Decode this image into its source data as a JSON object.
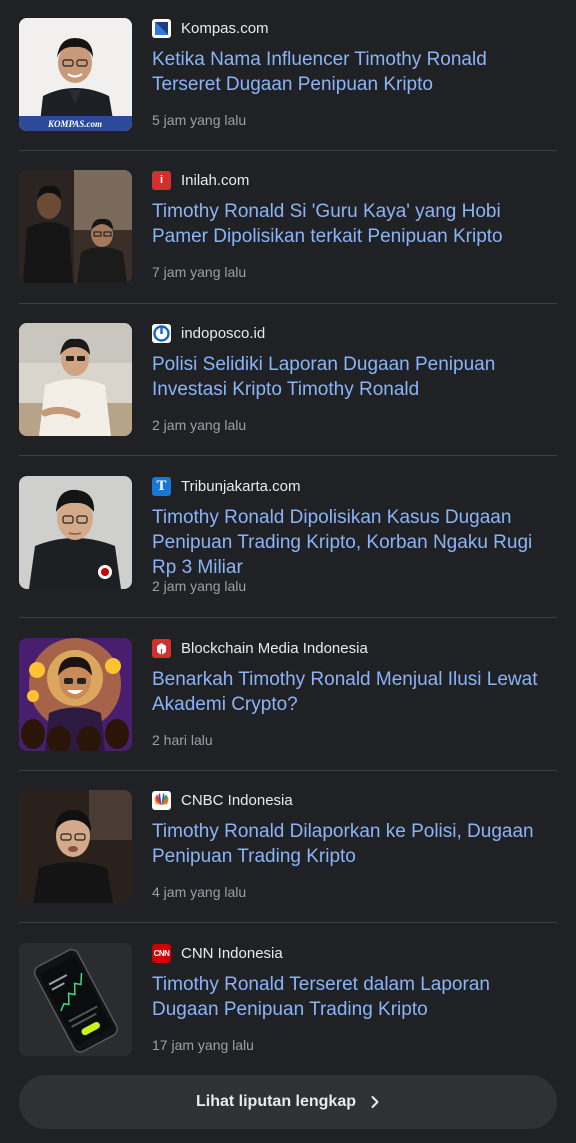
{
  "articles": [
    {
      "source": "Kompas.com",
      "favicon_icon": "kompas-logo-icon",
      "favicon_color": "#1a3c8a",
      "headline": "Ketika Nama Influencer Timothy Ronald Terseret Dugaan Penipuan Kripto",
      "time": "5 jam yang lalu",
      "thumb_watermark": "KOMPAS.com"
    },
    {
      "source": "Inilah.com",
      "favicon_icon": "inilah-logo-icon",
      "favicon_color": "#d32f2f",
      "headline": "Timothy Ronald Si 'Guru Kaya' yang Hobi Pamer Dipolisikan terkait Penipuan Kripto",
      "time": "7 jam yang lalu"
    },
    {
      "source": "indoposco.id",
      "favicon_icon": "indoposco-logo-icon",
      "favicon_color": "#1565c0",
      "headline": "Polisi Selidiki Laporan Dugaan Penipuan Investasi Kripto Timothy Ronald",
      "time": "2 jam yang lalu"
    },
    {
      "source": "Tribunjakarta.com",
      "favicon_icon": "tribun-logo-icon",
      "favicon_color": "#1976d2",
      "headline": "Timothy Ronald Dipolisikan Kasus Dugaan Penipuan Trading Kripto, Korban Ngaku Rugi Rp 3 Miliar",
      "time": "2 jam yang lalu"
    },
    {
      "source": "Blockchain Media Indonesia",
      "favicon_icon": "blockchain-media-logo-icon",
      "favicon_color": "#d32f2f",
      "headline": "Benarkah Timothy Ronald Menjual Ilusi Lewat Akademi Crypto?",
      "time": "2 hari lalu"
    },
    {
      "source": "CNBC Indonesia",
      "favicon_icon": "cnbc-peacock-icon",
      "favicon_color": "#ffffff",
      "headline": "Timothy Ronald Dilaporkan ke Polisi, Dugaan Penipuan Trading Kripto",
      "time": "4 jam yang lalu"
    },
    {
      "source": "CNN Indonesia",
      "favicon_icon": "cnn-logo-icon",
      "favicon_color": "#cc0000",
      "headline": "Timothy Ronald Terseret dalam Laporan Dugaan Penipuan Trading Kripto",
      "time": "17 jam yang lalu"
    }
  ],
  "full_coverage": {
    "label": "Lihat liputan lengkap",
    "icon": "chevron-right-icon"
  }
}
